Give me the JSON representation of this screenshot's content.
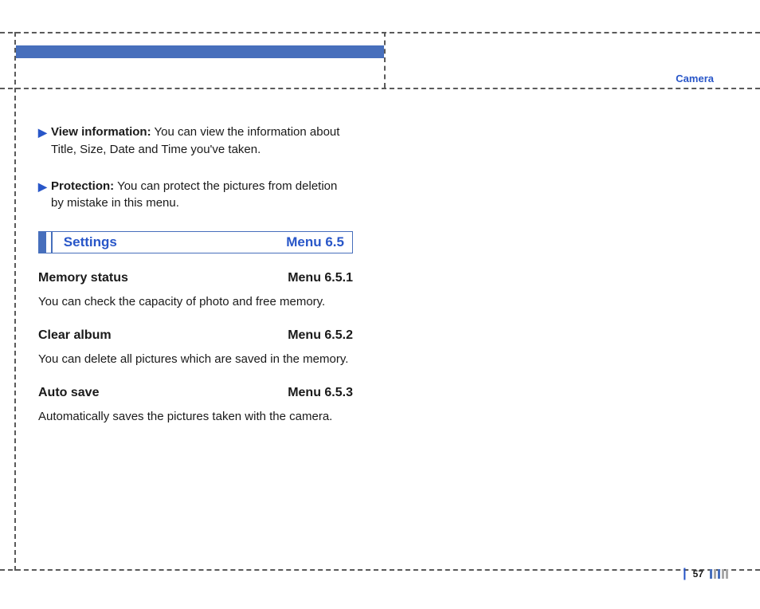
{
  "header": {
    "section": "Camera"
  },
  "bullets": [
    {
      "term": "View information:",
      "desc": "You can view the information about Title, Size, Date and Time you've taken."
    },
    {
      "term": "Protection:",
      "desc": "You can protect the pictures from deletion by mistake in this menu."
    }
  ],
  "settings": {
    "title": "Settings",
    "menu": "Menu 6.5",
    "items": [
      {
        "title": "Memory status",
        "menu": "Menu 6.5.1",
        "desc": "You can check the capacity of photo and free memory."
      },
      {
        "title": "Clear album",
        "menu": "Menu 6.5.2",
        "desc": "You can delete all pictures which are saved in the memory."
      },
      {
        "title": "Auto save",
        "menu": "Menu 6.5.3",
        "desc": "Automatically saves the pictures taken with the camera."
      }
    ]
  },
  "footer": {
    "page": "57"
  },
  "colors": {
    "accent": "#476fbc",
    "link": "#2856c8",
    "dash": "#5a5a5a"
  }
}
